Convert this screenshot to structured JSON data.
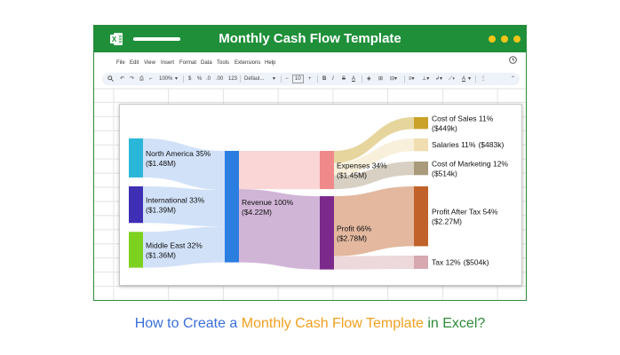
{
  "app": {
    "title": "Monthly Cash Flow Template",
    "icon": "excel-icon",
    "window_dot_color": "#f5c518",
    "titlebar_color": "#1f8f3a"
  },
  "menu": [
    "File",
    "Edit",
    "View",
    "Insert",
    "Format",
    "Data",
    "Tools",
    "Extensions",
    "Help"
  ],
  "toolbar": {
    "zoom": "100%",
    "currency": "$",
    "percent": "%",
    "decimal_decrease": ".0",
    "decimal_increase": ".00",
    "number_format": "123",
    "font": "Defaul...",
    "font_size": "10",
    "bold": "B",
    "italic": "I",
    "strikethrough": "S",
    "text_color": "A",
    "icons": [
      "search-icon",
      "undo-icon",
      "redo-icon",
      "print-icon",
      "paint-format-icon",
      "fill-color-icon",
      "borders-icon",
      "merge-icon",
      "align-icon",
      "valign-icon",
      "wrap-icon",
      "rotate-icon",
      "more-icon",
      "collapse-icon",
      "history-icon"
    ]
  },
  "chart_data": {
    "type": "sankey",
    "nodes": [
      {
        "id": "na",
        "label": "North America 35%",
        "value_label": "($1.48M)",
        "color": "#29b6d8"
      },
      {
        "id": "intl",
        "label": "International 33%",
        "value_label": "($1.39M)",
        "color": "#3f2fb5"
      },
      {
        "id": "me",
        "label": "Middle East 32%",
        "value_label": "($1.36M)",
        "color": "#7dd11f"
      },
      {
        "id": "rev",
        "label": "Revenue 100%",
        "value_label": "($4.22M)",
        "color": "#2b7de0"
      },
      {
        "id": "exp",
        "label": "Expenses 34%",
        "value_label": "($1.45M)",
        "color": "#f08a8a"
      },
      {
        "id": "profit",
        "label": "Profit 66%",
        "value_label": "($2.78M)",
        "color": "#7b2a8c"
      },
      {
        "id": "cos",
        "label": "Cost of Sales 11%",
        "value_label": "($449k)",
        "color": "#c9a227"
      },
      {
        "id": "sal",
        "label": "Salaries 11%",
        "value_label": "($483k)",
        "color": "#f0ddb0"
      },
      {
        "id": "mkt",
        "label": "Cost of Marketing 12%",
        "value_label": "($514k)",
        "color": "#a89a7a"
      },
      {
        "id": "pat",
        "label": "Profit After Tax 54%",
        "value_label": "($2.27M)",
        "color": "#c0622a"
      },
      {
        "id": "tax",
        "label": "Tax 12%",
        "value_label": "($504k)",
        "color": "#d8a8b0"
      }
    ],
    "links": [
      {
        "source": "na",
        "target": "rev",
        "value": 1.48
      },
      {
        "source": "intl",
        "target": "rev",
        "value": 1.39
      },
      {
        "source": "me",
        "target": "rev",
        "value": 1.36
      },
      {
        "source": "rev",
        "target": "exp",
        "value": 1.45
      },
      {
        "source": "rev",
        "target": "profit",
        "value": 2.78
      },
      {
        "source": "exp",
        "target": "cos",
        "value": 0.449
      },
      {
        "source": "exp",
        "target": "sal",
        "value": 0.483
      },
      {
        "source": "exp",
        "target": "mkt",
        "value": 0.514
      },
      {
        "source": "profit",
        "target": "pat",
        "value": 2.27
      },
      {
        "source": "profit",
        "target": "tax",
        "value": 0.504
      }
    ]
  },
  "caption": {
    "part1": "How to Create a ",
    "part2": "Monthly Cash Flow Template",
    "part3": " in Excel?"
  }
}
